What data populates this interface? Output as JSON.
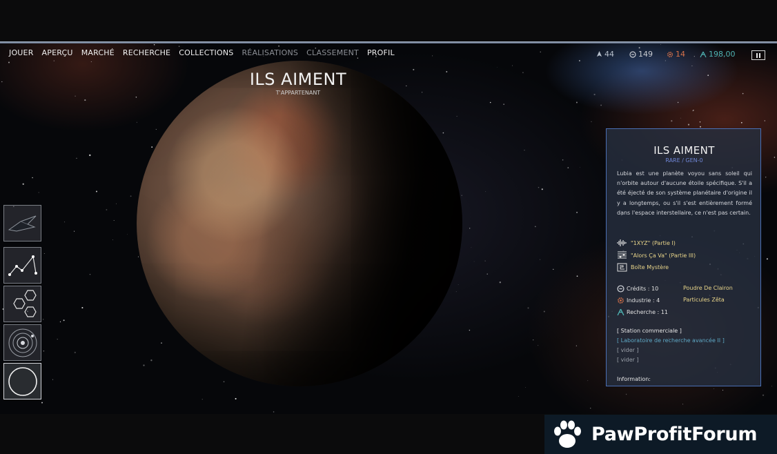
{
  "nav": {
    "items": [
      {
        "label": "JOUER",
        "dim": false
      },
      {
        "label": "APERÇU",
        "dim": false
      },
      {
        "label": "MARCHÉ",
        "dim": false
      },
      {
        "label": "RECHERCHE",
        "dim": false
      },
      {
        "label": "COLLECTIONS",
        "dim": false
      },
      {
        "label": "RÉALISATIONS",
        "dim": true
      },
      {
        "label": "CLASSEMENT",
        "dim": true
      },
      {
        "label": "PROFIL",
        "dim": false
      }
    ]
  },
  "resources": {
    "ships": {
      "value": "44",
      "icon": "ship-count-icon",
      "color": "#b7c0cc"
    },
    "credits": {
      "value": "149",
      "icon": "credits-icon",
      "color": "#c9ccd2"
    },
    "industry": {
      "value": "14",
      "icon": "industry-gear-icon",
      "color": "#d7724a"
    },
    "research": {
      "value": "198,00",
      "icon": "research-icon",
      "color": "#4fb3b3"
    }
  },
  "planet": {
    "name": "ILS AIMENT",
    "ownership": "T'APPARTENANT"
  },
  "side_tools": [
    {
      "icon": "spaceship-icon"
    },
    {
      "icon": "constellation-icon"
    },
    {
      "icon": "hexagons-icon"
    },
    {
      "icon": "solar-system-icon"
    },
    {
      "icon": "planet-circle-icon"
    }
  ],
  "panel": {
    "title": "ILS AIMENT",
    "rarity": "RARE / GEN-0",
    "description": "Lubia est une planète voyou sans soleil qui n'orbite autour d'aucune étoile spécifique. S'il a été éjecté de son système planétaire d'origine il y a longtemps, ou s'il s'est entièrement formé dans l'espace interstellaire, ce n'est pas certain.",
    "items": [
      {
        "icon": "audio-waveform-icon",
        "label": "\"1XYZ\" (Partie I)"
      },
      {
        "icon": "music-notes-icon",
        "label": "\"Alors Ça Va\" (Partie III)"
      },
      {
        "icon": "mystery-box-icon",
        "label": "Boîte Mystère"
      }
    ],
    "stats": [
      {
        "icon": "credits-icon",
        "label": "Crédits : 10"
      },
      {
        "icon": "industry-gear-icon",
        "label": "Industrie : 4"
      },
      {
        "icon": "research-icon",
        "label": "Recherche : 11"
      }
    ],
    "materials": [
      "Poudre De Clairon",
      "Particules Zêta"
    ],
    "slots": [
      {
        "label": "[ Station commerciale ]",
        "color": "#e6e6e6"
      },
      {
        "label": "[ Laboratoire de recherche avancée II ]",
        "color": "#5fa9c6"
      },
      {
        "label": "[ vider ]",
        "color": "#9aa0a8"
      },
      {
        "label": "[ vider ]",
        "color": "#9aa0a8"
      }
    ],
    "info_label": "Information:"
  },
  "watermark": {
    "text": "PawProfitForum",
    "icon": "paw-icon"
  }
}
